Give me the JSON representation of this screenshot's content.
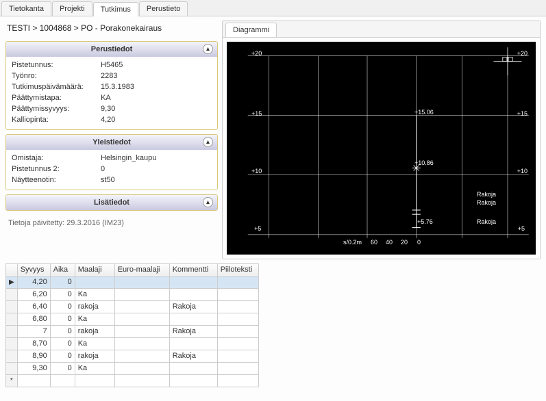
{
  "tabs": [
    "Tietokanta",
    "Projekti",
    "Tutkimus",
    "Perustieto"
  ],
  "active_tab": "Tutkimus",
  "breadcrumb": "TESTI > 1004868 > PO - Porakonekairaus",
  "panel_basic": {
    "title": "Perustiedot",
    "rows": [
      {
        "k": "Pistetunnus:",
        "v": "H5465"
      },
      {
        "k": "Työnro:",
        "v": "2283"
      },
      {
        "k": "Tutkimuspäivämäärä:",
        "v": "15.3.1983"
      },
      {
        "k": "Päättymistapa:",
        "v": "KA"
      },
      {
        "k": "Päättymissyvyys:",
        "v": "9,30"
      },
      {
        "k": "Kalliopinta:",
        "v": "4,20"
      }
    ]
  },
  "panel_general": {
    "title": "Yleistiedot",
    "rows": [
      {
        "k": "Omistaja:",
        "v": "Helsingin_kaupu"
      },
      {
        "k": "Pistetunnus 2:",
        "v": "0"
      },
      {
        "k": "Näytteenotin:",
        "v": "st50"
      }
    ]
  },
  "panel_extra": {
    "title": "Lisätiedot"
  },
  "updated_text": "Tietoja päivitetty: 29.3.2016 (IM23)",
  "diagram_tab": "Diagrammi",
  "diagram": {
    "y_ticks": [
      "+20",
      "+15",
      "+10",
      "+5"
    ],
    "x_label": "s/0.2m",
    "x_ticks": [
      "60",
      "40",
      "20",
      "0"
    ],
    "markers": [
      "+15.06",
      "+10.86",
      "+5.76"
    ],
    "annotations": [
      "Rakoja",
      "Rakoja",
      "Rakoja"
    ]
  },
  "grid": {
    "headers": [
      "Syvyys",
      "Aika",
      "Maalaji",
      "Euro-maalaji",
      "Kommentti",
      "Piiloteksti"
    ],
    "rows": [
      {
        "syv": "4,20",
        "aika": "0",
        "maa": "",
        "euro": "",
        "kom": "",
        "piil": ""
      },
      {
        "syv": "6,20",
        "aika": "0",
        "maa": "Ka",
        "euro": "",
        "kom": "",
        "piil": ""
      },
      {
        "syv": "6,40",
        "aika": "0",
        "maa": "rakoja",
        "euro": "",
        "kom": "Rakoja",
        "piil": ""
      },
      {
        "syv": "6,80",
        "aika": "0",
        "maa": "Ka",
        "euro": "",
        "kom": "",
        "piil": ""
      },
      {
        "syv": "7",
        "aika": "0",
        "maa": "rakoja",
        "euro": "",
        "kom": "Rakoja",
        "piil": ""
      },
      {
        "syv": "8,70",
        "aika": "0",
        "maa": "Ka",
        "euro": "",
        "kom": "",
        "piil": ""
      },
      {
        "syv": "8,90",
        "aika": "0",
        "maa": "rakoja",
        "euro": "",
        "kom": "Rakoja",
        "piil": ""
      },
      {
        "syv": "9,30",
        "aika": "0",
        "maa": "Ka",
        "euro": "",
        "kom": "",
        "piil": ""
      }
    ]
  },
  "row_marker": "▶",
  "new_row_marker": "*",
  "collapse_glyph": "▴"
}
